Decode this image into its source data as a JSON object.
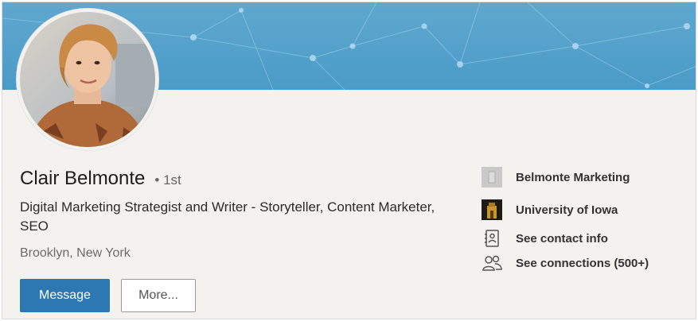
{
  "profile": {
    "name": "Clair Belmonte",
    "degree": "• 1st",
    "headline": "Digital Marketing Strategist and Writer - Storyteller, Content Marketer, SEO",
    "location": "Brooklyn, New York"
  },
  "actions": {
    "message_label": "Message",
    "more_label": "More..."
  },
  "sidebar": {
    "items": [
      {
        "label": "Belmonte Marketing",
        "icon": "company-logo-icon"
      },
      {
        "label": "University of Iowa",
        "icon": "university-logo-icon"
      },
      {
        "label": "See contact info",
        "icon": "contact-card-icon"
      },
      {
        "label": "See connections (500+)",
        "icon": "people-icon"
      }
    ]
  },
  "colors": {
    "banner": "#4a9bc7",
    "primary_button": "#2d78b3",
    "background": "#f3f2ef"
  }
}
